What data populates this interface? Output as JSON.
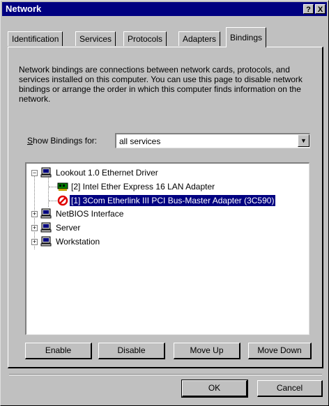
{
  "window": {
    "title": "Network",
    "help_label": "?",
    "close_label": "X"
  },
  "tabs": [
    {
      "label": "Identification",
      "active": false
    },
    {
      "label": "Services",
      "active": false
    },
    {
      "label": "Protocols",
      "active": false
    },
    {
      "label": "Adapters",
      "active": false
    },
    {
      "label": "Bindings",
      "active": true
    }
  ],
  "bindings": {
    "description": "Network bindings are connections between network cards, protocols, and services installed on this computer. You can use this page to disable network bindings or arrange the order in which this computer finds information on the network.",
    "show_label": "Show Bindings for:",
    "show_value": "all services",
    "tree": [
      {
        "label": "Lookout 1.0 Ethernet Driver",
        "expand": "−",
        "icon": "computer-icon"
      },
      {
        "label": "[2] Intel Ether Express 16 LAN Adapter",
        "icon": "network-card-icon"
      },
      {
        "label": "[1] 3Com Etherlink III PCI Bus-Master Adapter (3C590)",
        "icon": "disabled-icon",
        "selected": true
      },
      {
        "label": "NetBIOS Interface",
        "expand": "+",
        "icon": "computer-icon"
      },
      {
        "label": "Server",
        "expand": "+",
        "icon": "computer-icon"
      },
      {
        "label": "Workstation",
        "expand": "+",
        "icon": "computer-icon"
      }
    ],
    "buttons": {
      "enable": "Enable",
      "disable": "Disable",
      "move_up": "Move Up",
      "move_down": "Move Down"
    }
  },
  "footer": {
    "ok": "OK",
    "cancel": "Cancel"
  },
  "colors": {
    "title_bg": "#000080",
    "face": "#c0c0c0",
    "selection": "#000080",
    "disabled_red": "#e00000"
  }
}
